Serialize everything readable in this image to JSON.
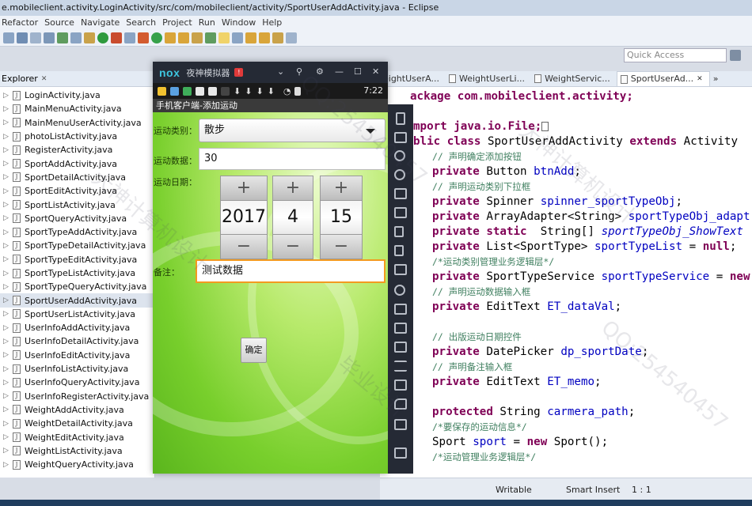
{
  "window_title": "e.mobileclient.activity.LoginActivity/src/com/mobileclient/activity/SportUserAddActivity.java - Eclipse",
  "menu": [
    "Refactor",
    "Source",
    "Navigate",
    "Search",
    "Project",
    "Run",
    "Window",
    "Help"
  ],
  "quick_access": "Quick Access",
  "explorer": {
    "tab": "Explorer",
    "files": [
      "LoginActivity.java",
      "MainMenuActivity.java",
      "MainMenuUserActivity.java",
      "photoListActivity.java",
      "RegisterActivity.java",
      "SportAddActivity.java",
      "SportDetailActivity.java",
      "SportEditActivity.java",
      "SportListActivity.java",
      "SportQueryActivity.java",
      "SportTypeAddActivity.java",
      "SportTypeDetailActivity.java",
      "SportTypeEditActivity.java",
      "SportTypeListActivity.java",
      "SportTypeQueryActivity.java",
      "SportUserAddActivity.java",
      "SportUserListActivity.java",
      "UserInfoAddActivity.java",
      "UserInfoDetailActivity.java",
      "UserInfoEditActivity.java",
      "UserInfoListActivity.java",
      "UserInfoQueryActivity.java",
      "UserInfoRegisterActivity.java",
      "WeightAddActivity.java",
      "WeightDetailActivity.java",
      "WeightEditActivity.java",
      "WeightListActivity.java",
      "WeightQueryActivity.java"
    ]
  },
  "editor": {
    "tabs": [
      "eightUserA...",
      "WeightUserLi...",
      "WeightServic...",
      "SportUserAd..."
    ],
    "overflow_tab": "»",
    "code": {
      "l1": "ackage com.mobileclient.activity;",
      "l2": "mport java.io.File;",
      "l3_kw": "blic class",
      "l3_name": " SportUserAddActivity ",
      "l3_ext": "extends",
      "l3_rest": " Activity",
      "c1": "// 声明确定添加按钮",
      "l4": "Button",
      "l4_f": "btnAdd",
      "c2": "// 声明运动类别下拉框",
      "l5": "Spinner",
      "l5_f": "spinner_sportTypeObj",
      "l6": "ArrayAdapter<String>",
      "l6_f": "sportTypeObj_adapt",
      "l7": "String[]",
      "l7_f": "sportTypeObj_ShowText",
      "l8": "List<SportType>",
      "l8_f": "sportTypeList",
      "l8_v": "null",
      "c3": "/*运动类别管理业务逻辑层*/",
      "l9": "SportTypeService",
      "l9_f": "sportTypeService",
      "l9_v": "new",
      "c4": "// 声明运动数据输入框",
      "l10": "EditText",
      "l10_f": "ET_dataVal",
      "c5": "// 出版运动日期控件",
      "l11": "DatePicker",
      "l11_f": "dp_sportDate",
      "c6": "// 声明备注输入框",
      "l12": "EditText",
      "l12_f": "ET_memo",
      "l13_kw": "protected",
      "l13": "String",
      "l13_f": "carmera_path",
      "c7": "/*要保存的运动信息*/",
      "l14": "Sport",
      "l14_f": "sport",
      "l14_v": "new",
      "l14_r": "Sport();",
      "c8": "/*运动管理业务逻辑层*/",
      "private": "private",
      "static": "static"
    }
  },
  "status": {
    "writable": "Writable",
    "insert": "Smart Insert",
    "pos": "1 : 1"
  },
  "nox": {
    "logo": "nox",
    "name": "夜神模拟器",
    "badge": "!",
    "time": "7:22",
    "app_title": "手机客户端-添加运动",
    "form": {
      "type_label": "运动类别：",
      "type_value": "散步",
      "data_label": "运动数据：",
      "data_value": "30",
      "date_label": "运动日期：",
      "year": "2017",
      "month": "4",
      "day": "15",
      "memo_label": "备注：",
      "memo_value": "测试数据",
      "confirm": "确定"
    }
  },
  "watermarks": [
    "QQ:254540457",
    "大神计算机设计",
    "毕业设计"
  ]
}
